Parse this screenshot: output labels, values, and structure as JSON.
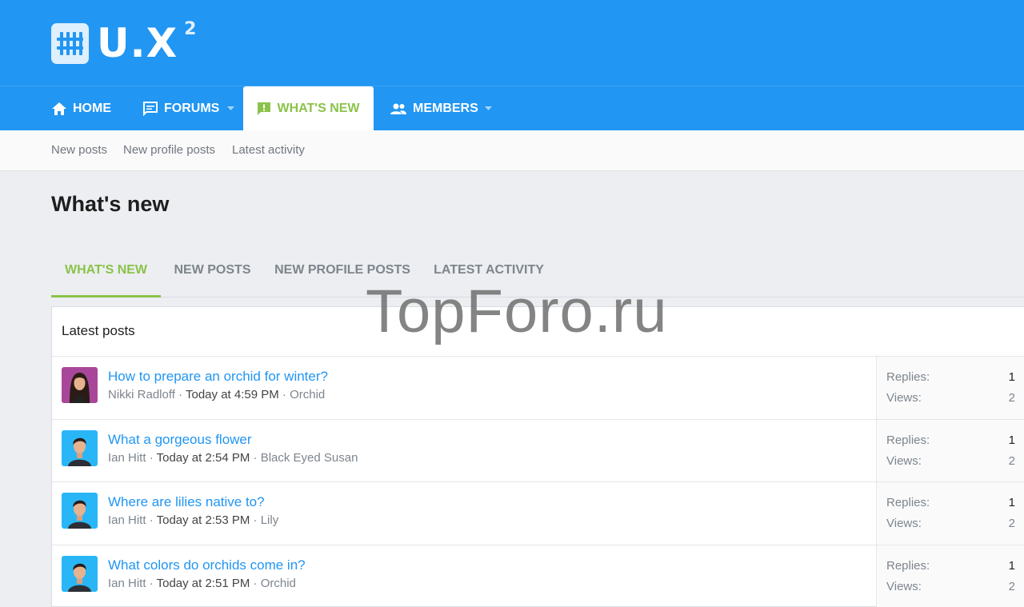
{
  "logo": {
    "text": "U.X",
    "sup": "2"
  },
  "nav": [
    {
      "label": "HOME"
    },
    {
      "label": "FORUMS"
    },
    {
      "label": "WHAT'S NEW"
    },
    {
      "label": "MEMBERS"
    }
  ],
  "subnav": [
    "New posts",
    "New profile posts",
    "Latest activity"
  ],
  "page_title": "What's new",
  "tabs": [
    "WHAT'S NEW",
    "NEW POSTS",
    "NEW PROFILE POSTS",
    "LATEST ACTIVITY"
  ],
  "block_title": "Latest posts",
  "threads": [
    {
      "title": "How to prepare an orchid for winter?",
      "author": "Nikki Radloff",
      "time": "Today at 4:59 PM",
      "forum": "Orchid",
      "replies_label": "Replies:",
      "replies": "1",
      "views_label": "Views:",
      "views": "2"
    },
    {
      "title": "What a gorgeous flower",
      "author": "Ian Hitt",
      "time": "Today at 2:54 PM",
      "forum": "Black Eyed Susan",
      "replies_label": "Replies:",
      "replies": "1",
      "views_label": "Views:",
      "views": "2"
    },
    {
      "title": "Where are lilies native to?",
      "author": "Ian Hitt",
      "time": "Today at 2:53 PM",
      "forum": "Lily",
      "replies_label": "Replies:",
      "replies": "1",
      "views_label": "Views:",
      "views": "2"
    },
    {
      "title": "What colors do orchids come in?",
      "author": "Ian Hitt",
      "time": "Today at 2:51 PM",
      "forum": "Orchid",
      "replies_label": "Replies:",
      "replies": "1",
      "views_label": "Views:",
      "views": "2"
    }
  ],
  "separator": "·",
  "watermark": "TopForo.ru",
  "colors": {
    "brand": "#2196f3",
    "accent": "#8bc34a",
    "link": "#2196f3"
  }
}
